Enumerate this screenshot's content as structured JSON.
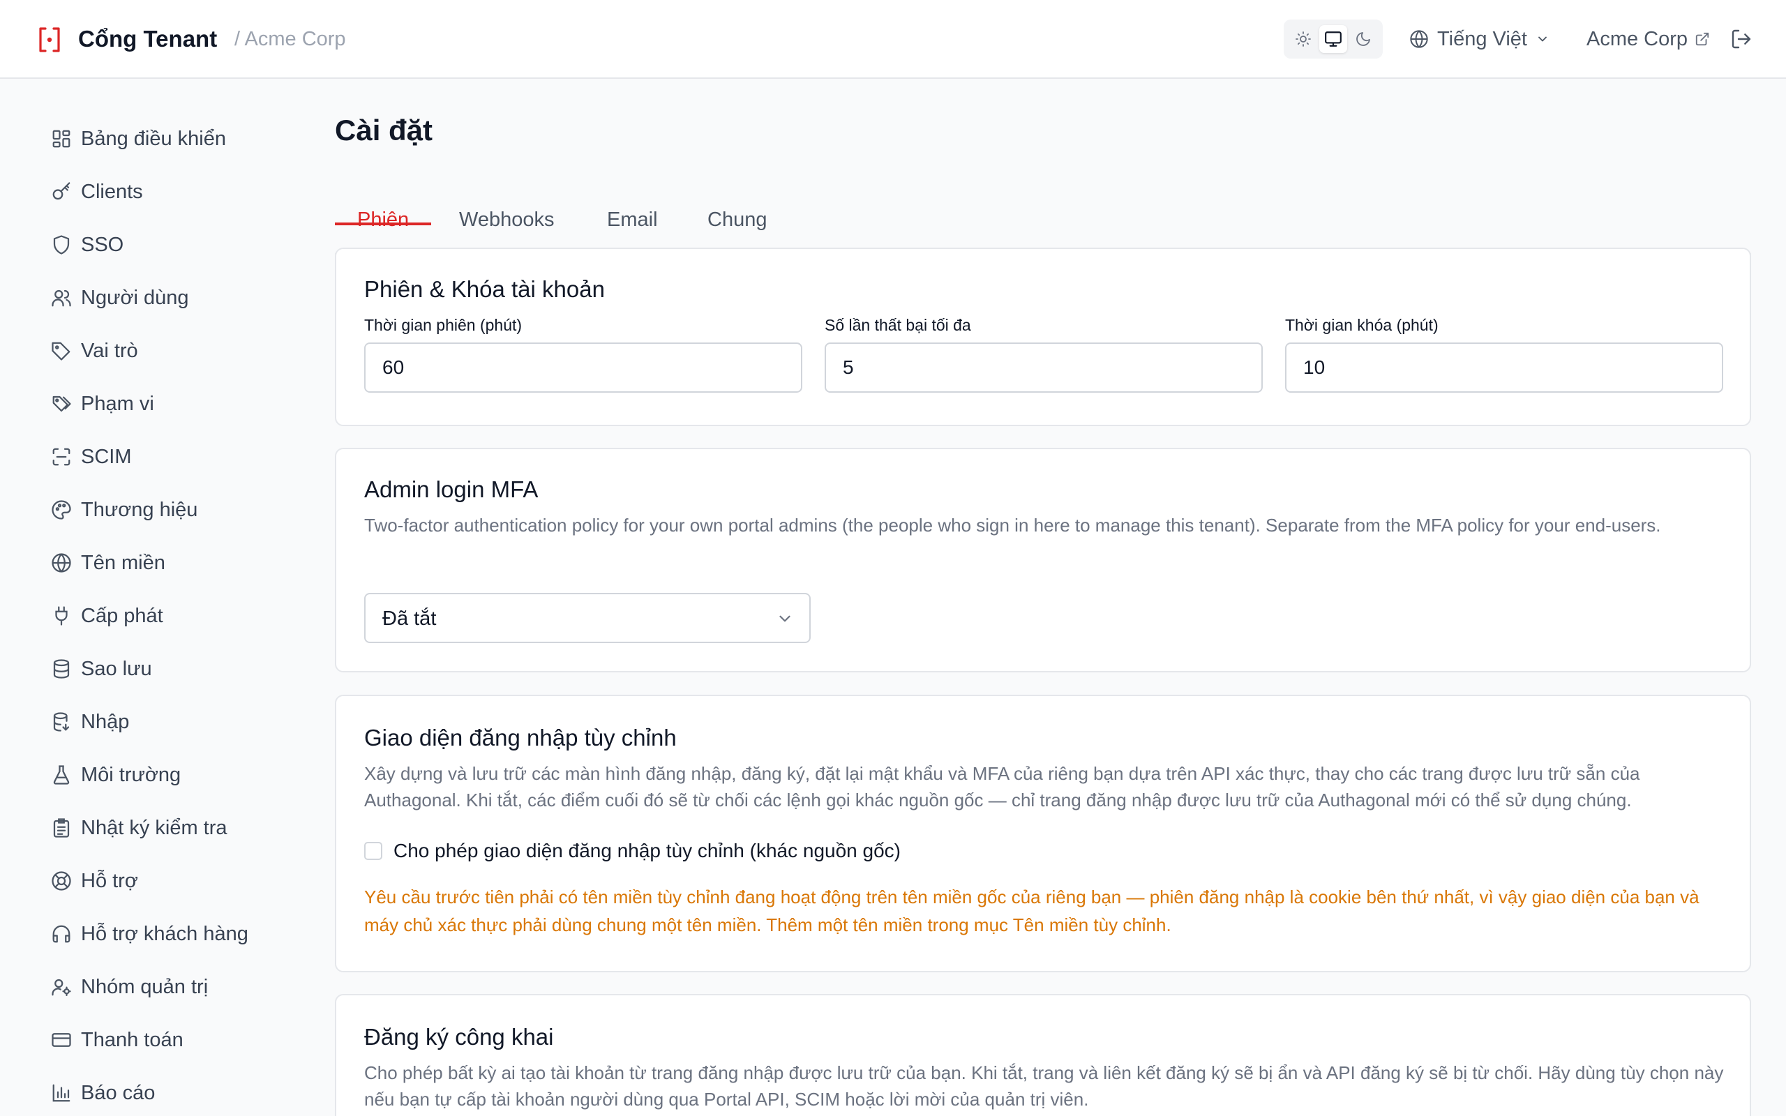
{
  "header": {
    "app_name": "Cổng Tenant",
    "tenant": "/ Acme Corp",
    "theme_options": [
      "light-icon",
      "monitor-icon",
      "moon-icon"
    ],
    "theme_selected": "monitor",
    "language": "Tiếng Việt",
    "org_link": "Acme Corp",
    "accent_color": "#dc2626"
  },
  "sidebar": {
    "items": [
      {
        "label": "Bảng điều khiển",
        "icon": "dashboard-icon"
      },
      {
        "label": "Clients",
        "icon": "key-icon"
      },
      {
        "label": "SSO",
        "icon": "shield-icon"
      },
      {
        "label": "Người dùng",
        "icon": "users-icon"
      },
      {
        "label": "Vai trò",
        "icon": "tag-icon"
      },
      {
        "label": "Phạm vi",
        "icon": "tags-icon"
      },
      {
        "label": "SCIM",
        "icon": "scan-icon"
      },
      {
        "label": "Thương hiệu",
        "icon": "palette-icon"
      },
      {
        "label": "Tên miền",
        "icon": "globe-icon"
      },
      {
        "label": "Cấp phát",
        "icon": "plug-icon"
      },
      {
        "label": "Sao lưu",
        "icon": "database-icon"
      },
      {
        "label": "Nhập",
        "icon": "database-import-icon"
      },
      {
        "label": "Môi trường",
        "icon": "flask-icon"
      },
      {
        "label": "Nhật ký kiểm tra",
        "icon": "clipboard-icon"
      },
      {
        "label": "Hỗ trợ",
        "icon": "lifebuoy-icon"
      },
      {
        "label": "Hỗ trợ khách hàng",
        "icon": "headphones-icon"
      },
      {
        "label": "Nhóm quản trị",
        "icon": "user-cog-icon"
      },
      {
        "label": "Thanh toán",
        "icon": "credit-card-icon"
      },
      {
        "label": "Báo cáo",
        "icon": "bar-chart-icon"
      }
    ]
  },
  "main": {
    "title": "Cài đặt",
    "tabs": [
      {
        "label": "Phiên",
        "active": true
      },
      {
        "label": "Webhooks",
        "active": false
      },
      {
        "label": "Email",
        "active": false
      },
      {
        "label": "Chung",
        "active": false
      }
    ],
    "session_card": {
      "title": "Phiên & Khóa tài khoản",
      "fields": [
        {
          "label": "Thời gian phiên (phút)",
          "value": "60"
        },
        {
          "label": "Số lần thất bại tối đa",
          "value": "5"
        },
        {
          "label": "Thời gian khóa (phút)",
          "value": "10"
        }
      ]
    },
    "mfa_card": {
      "title": "Admin login MFA",
      "description": "Two-factor authentication policy for your own portal admins (the people who sign in here to manage this tenant). Separate from the MFA policy for your end-users.",
      "select_value": "Đã tắt"
    },
    "custom_login_card": {
      "title": "Giao diện đăng nhập tùy chỉnh",
      "description": "Xây dựng và lưu trữ các màn hình đăng nhập, đăng ký, đặt lại mật khẩu và MFA của riêng bạn dựa trên API xác thực, thay cho các trang được lưu trữ sẵn của Authagonal. Khi tắt, các điểm cuối đó sẽ từ chối các lệnh gọi khác nguồn gốc — chỉ trang đăng nhập được lưu trữ của Authagonal mới có thể sử dụng chúng.",
      "checkbox_label": "Cho phép giao diện đăng nhập tùy chỉnh (khác nguồn gốc)",
      "checkbox_checked": false,
      "warning": "Yêu cầu trước tiên phải có tên miền tùy chỉnh đang hoạt động trên tên miền gốc của riêng bạn — phiên đăng nhập là cookie bên thứ nhất, vì vậy giao diện của bạn và máy chủ xác thực phải dùng chung một tên miền. Thêm một tên miền trong mục Tên miền tùy chỉnh.",
      "warning_color": "#d97706"
    },
    "public_signup_card": {
      "title": "Đăng ký công khai",
      "description": "Cho phép bất kỳ ai tạo tài khoản từ trang đăng nhập được lưu trữ của bạn. Khi tắt, trang và liên kết đăng ký sẽ bị ẩn và API đăng ký sẽ bị từ chối. Hãy dùng tùy chọn này nếu bạn tự cấp tài khoản người dùng qua Portal API, SCIM hoặc lời mời của quản trị viên."
    }
  }
}
